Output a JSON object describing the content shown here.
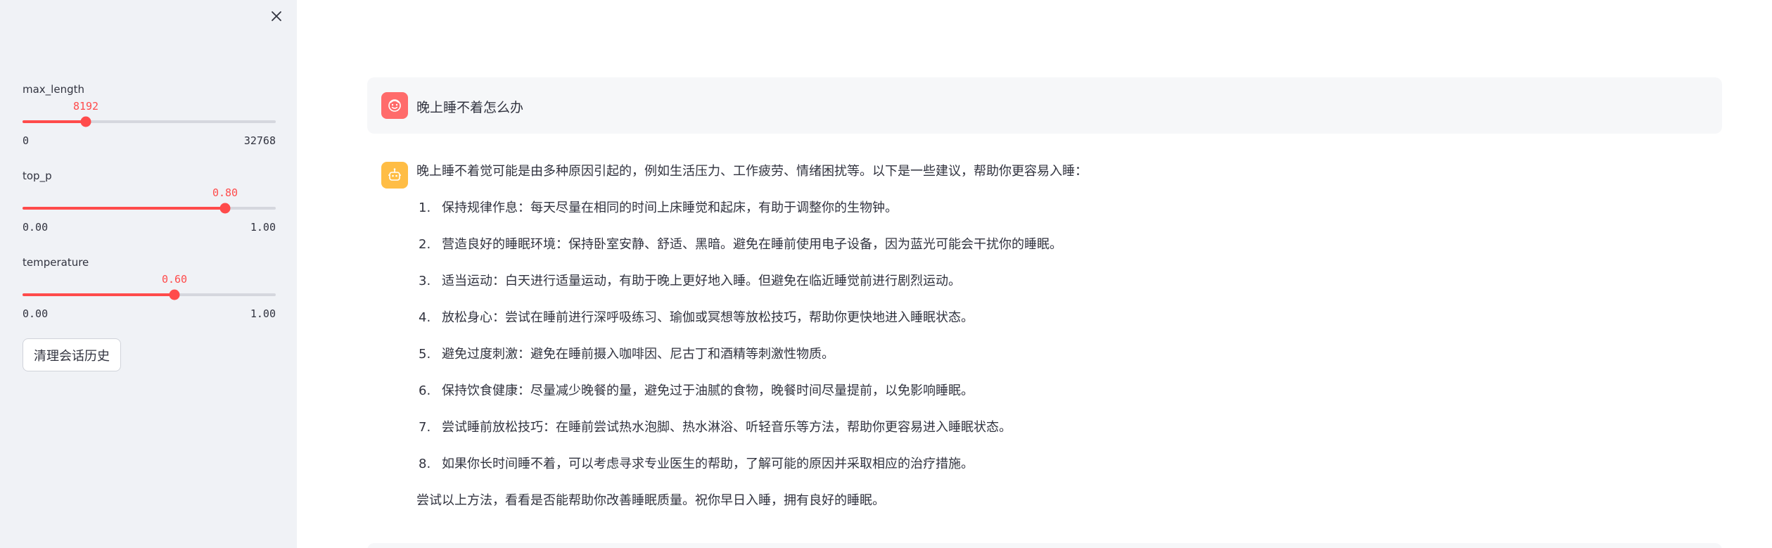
{
  "sidebar": {
    "close_icon": "close-icon",
    "sliders": [
      {
        "label": "max_length",
        "value": "8192",
        "min": "0",
        "max": "32768",
        "fraction": 0.25
      },
      {
        "label": "top_p",
        "value": "0.80",
        "min": "0.00",
        "max": "1.00",
        "fraction": 0.8
      },
      {
        "label": "temperature",
        "value": "0.60",
        "min": "0.00",
        "max": "1.00",
        "fraction": 0.6
      }
    ],
    "clear_button": "清理会话历史"
  },
  "chat": {
    "user": {
      "avatar_icon": "user-face-icon",
      "text": "晚上睡不着怎么办"
    },
    "assistant": {
      "avatar_icon": "robot-icon",
      "intro": "晚上睡不着觉可能是由多种原因引起的，例如生活压力、工作疲劳、情绪困扰等。以下是一些建议，帮助你更容易入睡：",
      "items": [
        {
          "num": "1.",
          "text": "保持规律作息：每天尽量在相同的时间上床睡觉和起床，有助于调整你的生物钟。"
        },
        {
          "num": "2.",
          "text": "营造良好的睡眠环境：保持卧室安静、舒适、黑暗。避免在睡前使用电子设备，因为蓝光可能会干扰你的睡眠。"
        },
        {
          "num": "3.",
          "text": "适当运动：白天进行适量运动，有助于晚上更好地入睡。但避免在临近睡觉前进行剧烈运动。"
        },
        {
          "num": "4.",
          "text": "放松身心：尝试在睡前进行深呼吸练习、瑜伽或冥想等放松技巧，帮助你更快地进入睡眠状态。"
        },
        {
          "num": "5.",
          "text": "避免过度刺激：避免在睡前摄入咖啡因、尼古丁和酒精等刺激性物质。"
        },
        {
          "num": "6.",
          "text": "保持饮食健康：尽量减少晚餐的量，避免过于油腻的食物，晚餐时间尽量提前，以免影响睡眠。"
        },
        {
          "num": "7.",
          "text": "尝试睡前放松技巧：在睡前尝试热水泡脚、热水淋浴、听轻音乐等方法，帮助你更容易进入睡眠状态。"
        },
        {
          "num": "8.",
          "text": "如果你长时间睡不着，可以考虑寻求专业医生的帮助，了解可能的原因并采取相应的治疗措施。"
        }
      ],
      "outro": "尝试以上方法，看看是否能帮助你改善睡眠质量。祝你早日入睡，拥有良好的睡眠。"
    }
  },
  "colors": {
    "accent": "#ff4b4b",
    "sidebar_bg": "#f0f2f6",
    "user_avatar": "#ff6b6b",
    "bot_avatar": "#ffbd45"
  }
}
